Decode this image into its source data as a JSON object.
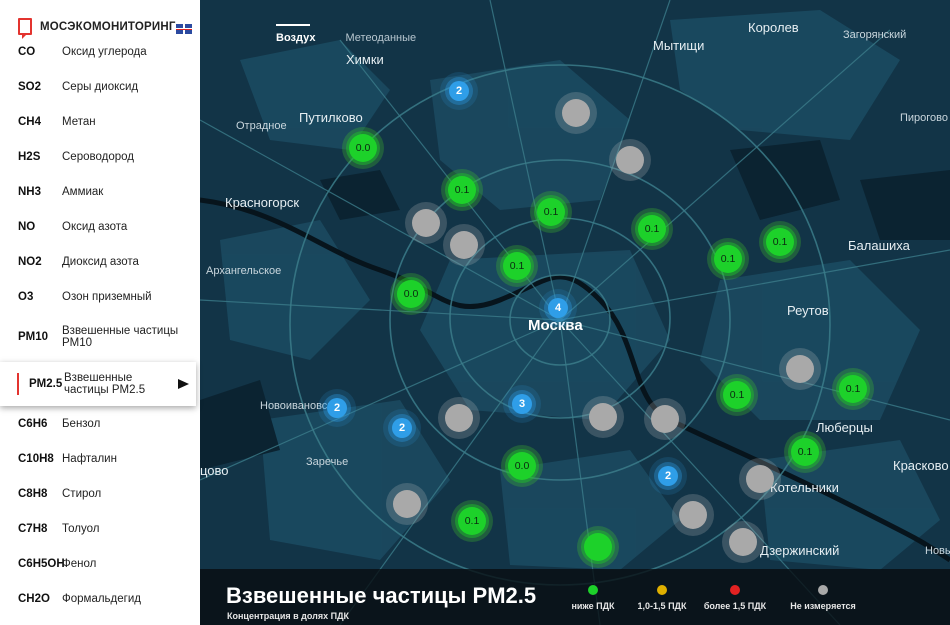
{
  "brand": {
    "title": "МОСЭКОМОНИТОРИНГ"
  },
  "sidebar": {
    "items": [
      {
        "code": "CO",
        "name": "Оксид углерода"
      },
      {
        "code": "SO2",
        "name": "Серы диоксид"
      },
      {
        "code": "CH4",
        "name": "Метан"
      },
      {
        "code": "H2S",
        "name": "Сероводород"
      },
      {
        "code": "NH3",
        "name": "Аммиак"
      },
      {
        "code": "NO",
        "name": "Оксид азота"
      },
      {
        "code": "NO2",
        "name": "Диоксид азота"
      },
      {
        "code": "O3",
        "name": "Озон приземный"
      },
      {
        "code": "PM10",
        "name": "Взвешенные частицы PM10"
      },
      {
        "code": "PM2.5",
        "name": "Взвешенные частицы PM2.5"
      },
      {
        "code": "C6H6",
        "name": "Бензол"
      },
      {
        "code": "C10H8",
        "name": "Нафталин"
      },
      {
        "code": "C8H8",
        "name": "Стирол"
      },
      {
        "code": "C7H8",
        "name": "Толуол"
      },
      {
        "code": "C6H5OH",
        "name": "Фенол"
      },
      {
        "code": "CH2O",
        "name": "Формальдегид"
      }
    ]
  },
  "tabs": [
    "Воздух",
    "Метеоданные"
  ],
  "map_labels": [
    {
      "text": "Химки"
    },
    {
      "text": "Мытищи"
    },
    {
      "text": "Королев"
    },
    {
      "text": "Путилково"
    },
    {
      "text": "Красногорск"
    },
    {
      "text": "Балашиха"
    },
    {
      "text": "Москва"
    },
    {
      "text": "Реутов"
    },
    {
      "text": "Люберцы"
    },
    {
      "text": "Котельники"
    },
    {
      "text": "Дзержинский"
    },
    {
      "text": "Красково"
    },
    {
      "text": "Отрадное"
    },
    {
      "text": "Архангельское"
    },
    {
      "text": "Новоивановское"
    },
    {
      "text": "Заречье"
    },
    {
      "text": "цово"
    },
    {
      "text": "Загорянский"
    },
    {
      "text": "Пирогово"
    },
    {
      "text": "Новый"
    }
  ],
  "stations": [
    {
      "kind": "cluster",
      "label": "2"
    },
    {
      "kind": "gray",
      "label": ""
    },
    {
      "kind": "green",
      "label": "0.0"
    },
    {
      "kind": "gray",
      "label": ""
    },
    {
      "kind": "green",
      "label": "0.1"
    },
    {
      "kind": "green",
      "label": "0.1"
    },
    {
      "kind": "gray",
      "label": ""
    },
    {
      "kind": "gray",
      "label": ""
    },
    {
      "kind": "green",
      "label": "0.1"
    },
    {
      "kind": "green",
      "label": "0.1"
    },
    {
      "kind": "green",
      "label": "0.1"
    },
    {
      "kind": "green",
      "label": "0.1"
    },
    {
      "kind": "green",
      "label": "0.0"
    },
    {
      "kind": "cluster",
      "label": "4"
    },
    {
      "kind": "gray",
      "label": ""
    },
    {
      "kind": "green",
      "label": "0.1"
    },
    {
      "kind": "green",
      "label": "0.1"
    },
    {
      "kind": "cluster",
      "label": "2"
    },
    {
      "kind": "gray",
      "label": ""
    },
    {
      "kind": "cluster",
      "label": "3"
    },
    {
      "kind": "gray",
      "label": ""
    },
    {
      "kind": "gray",
      "label": ""
    },
    {
      "kind": "cluster",
      "label": "2"
    },
    {
      "kind": "green",
      "label": "0.0"
    },
    {
      "kind": "green",
      "label": "0.1"
    },
    {
      "kind": "cluster",
      "label": "2"
    },
    {
      "kind": "gray",
      "label": ""
    },
    {
      "kind": "gray",
      "label": ""
    },
    {
      "kind": "gray",
      "label": ""
    },
    {
      "kind": "green",
      "label": "0.1"
    },
    {
      "kind": "gray",
      "label": ""
    }
  ],
  "legend": {
    "title": "Взвешенные частицы PM2.5",
    "subtitle": "Концентрация в долях ПДК",
    "items": [
      {
        "label": "ниже ПДК",
        "color": "#1dd12a"
      },
      {
        "label": "1,0-1,5 ПДК",
        "color": "#e0b000"
      },
      {
        "label": "более 1,5 ПДК",
        "color": "#e32222"
      },
      {
        "label": "Не измеряется",
        "color": "#a9a9a9"
      }
    ]
  },
  "colors": {
    "accent": "#e3342f",
    "map_bg": "#123447",
    "green": "#1dd12a",
    "cluster": "#2f9ee8"
  }
}
